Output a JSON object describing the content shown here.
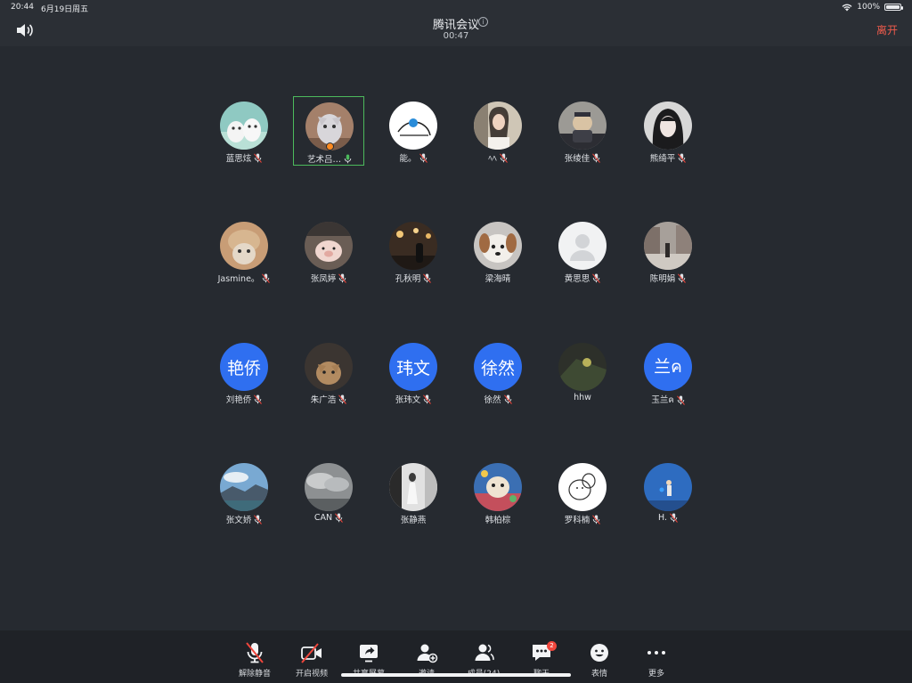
{
  "status": {
    "time": "20:44",
    "date": "6月19日周五",
    "battery": "100%"
  },
  "header": {
    "title": "腾讯会议",
    "timer": "00:47",
    "leave": "离开",
    "info_glyph": "i"
  },
  "participants": [
    {
      "name": "蓝思炫",
      "avatar": "photo-cartoon",
      "mic": "muted"
    },
    {
      "name": "艺术吕…",
      "avatar": "photo-cat",
      "mic": "active",
      "highlighted": true
    },
    {
      "name": "能。",
      "avatar": "photo-sketch",
      "mic": "muted"
    },
    {
      "name": "ﾍﾍ",
      "avatar": "photo-woman",
      "mic": "muted"
    },
    {
      "name": "张绫佳",
      "avatar": "photo-dog",
      "mic": "muted"
    },
    {
      "name": "熊绮平",
      "avatar": "photo-girl",
      "mic": "muted"
    },
    {
      "name": "Jasmine。",
      "avatar": "photo-knit",
      "mic": "muted"
    },
    {
      "name": "张凤婷",
      "avatar": "photo-pig",
      "mic": "muted"
    },
    {
      "name": "孔秋明",
      "avatar": "photo-night",
      "mic": "muted"
    },
    {
      "name": "梁海晴",
      "avatar": "photo-puppy",
      "mic": "none"
    },
    {
      "name": "黄思思",
      "avatar": "photo-default",
      "mic": "muted"
    },
    {
      "name": "陈明娟",
      "avatar": "photo-street",
      "mic": "muted"
    },
    {
      "name": "刘艳侨",
      "avatar_text": "艳侨",
      "mic": "muted"
    },
    {
      "name": "朱广浩",
      "avatar": "photo-kitten",
      "mic": "muted"
    },
    {
      "name": "张玮文",
      "avatar_text": "玮文",
      "mic": "muted"
    },
    {
      "name": "徐然",
      "avatar_text": "徐然",
      "mic": "muted"
    },
    {
      "name": "hhw",
      "avatar": "photo-dark",
      "mic": "none"
    },
    {
      "name": "玉兰ค",
      "avatar_text": "兰ค",
      "mic": "muted"
    },
    {
      "name": "张文娇",
      "avatar": "photo-landscape",
      "mic": "muted"
    },
    {
      "name": "CAN",
      "avatar": "photo-cloud",
      "mic": "muted"
    },
    {
      "name": "张静燕",
      "avatar": "photo-bw",
      "mic": "none"
    },
    {
      "name": "韩柏棕",
      "avatar": "photo-colorful",
      "mic": "none"
    },
    {
      "name": "罗科楠",
      "avatar": "photo-doodle",
      "mic": "muted"
    },
    {
      "name": "H.",
      "avatar": "photo-blue",
      "mic": "muted"
    }
  ],
  "toolbar": {
    "unmute": "解除静音",
    "video": "开启视频",
    "share": "共享屏幕",
    "invite": "邀请",
    "members": "成员(24)",
    "chat": "聊天",
    "chat_badge": "2",
    "emoji": "表情",
    "more": "更多"
  },
  "colors": {
    "background": "#262a30",
    "accent_blue": "#2f6ff0",
    "leave_red": "#f05b4c",
    "active_green": "#4cba5c"
  }
}
